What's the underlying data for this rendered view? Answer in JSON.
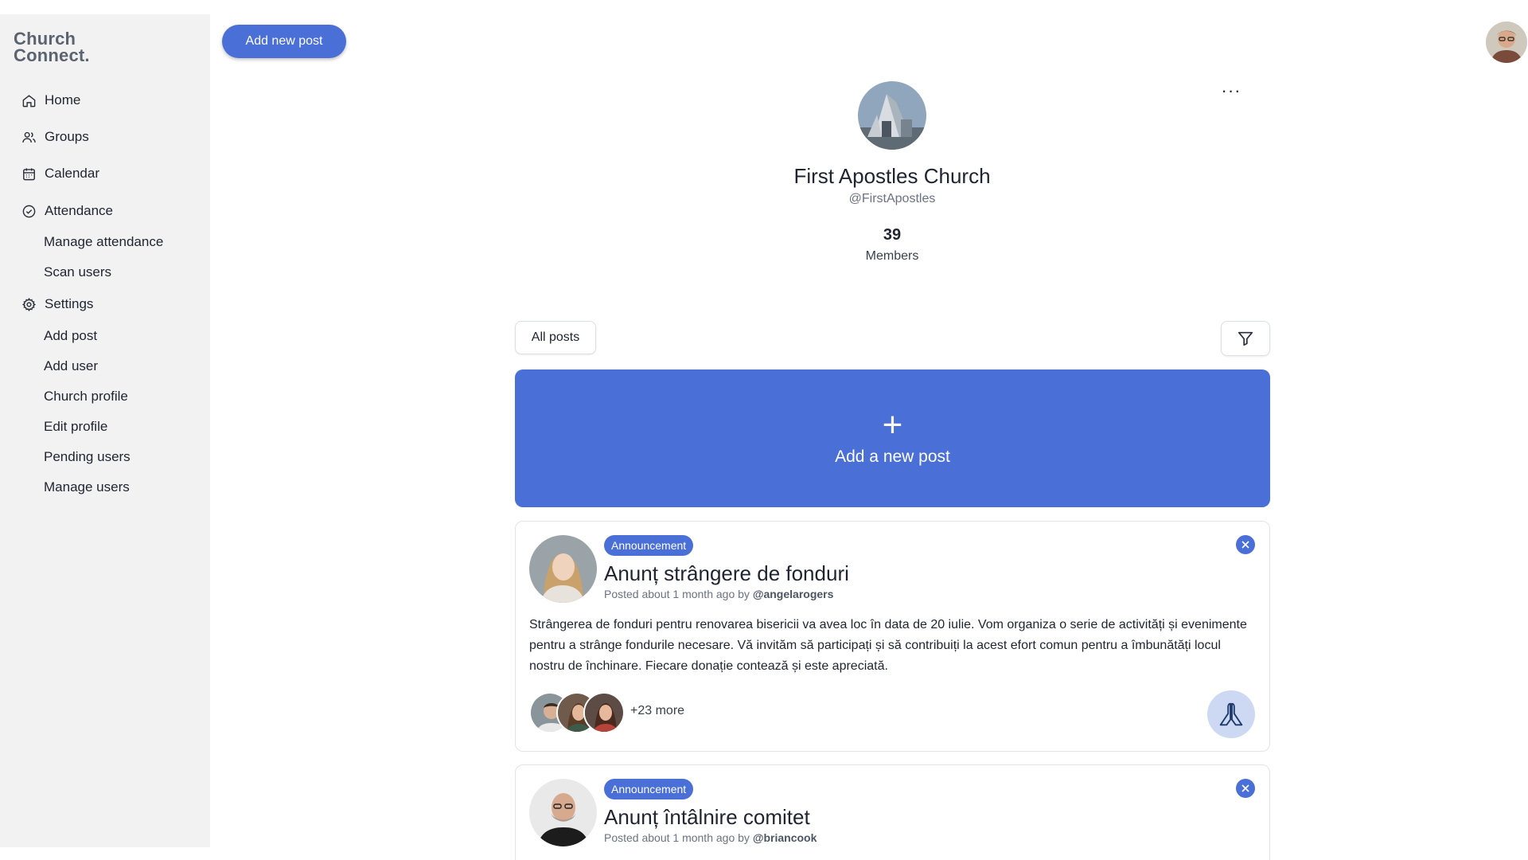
{
  "app": {
    "logo_line1": "Church",
    "logo_line2": "Connect.",
    "top_button": "Add new post"
  },
  "sidebar": {
    "items": [
      {
        "label": "Home",
        "icon": "home-icon"
      },
      {
        "label": "Groups",
        "icon": "users-icon"
      },
      {
        "label": "Calendar",
        "icon": "calendar-icon"
      },
      {
        "label": "Attendance",
        "icon": "check-circle-icon"
      },
      {
        "label": "Settings",
        "icon": "gear-icon"
      }
    ],
    "attendance_sub": [
      "Manage attendance",
      "Scan users"
    ],
    "settings_sub": [
      "Add post",
      "Add user",
      "Church profile",
      "Edit profile",
      "Pending users",
      "Manage users"
    ]
  },
  "church": {
    "name": "First Apostles Church",
    "handle": "@FirstApostles",
    "members_count": "39",
    "members_label": "Members",
    "more_menu": "···"
  },
  "feed": {
    "filter_label": "All posts",
    "add_post_plus": "+",
    "add_post_label": "Add a new post",
    "posts": [
      {
        "badge": "Announcement",
        "title": "Anunț strângere de fonduri",
        "meta_prefix": "Posted about 1 month ago by ",
        "author": "@angelarogers",
        "body": "Strângerea de fonduri pentru renovarea bisericii va avea loc în data de 20 iulie. Vom organiza o serie de activități și evenimente pentru a strânge fondurile necesare. Vă invităm să participați și să contribuiți la acest efort comun pentru a îmbunătăți locul nostru de închinare. Fiecare donație contează și este apreciată.",
        "more_reactions": "+23 more"
      },
      {
        "badge": "Announcement",
        "title": "Anunț întâlnire comitet",
        "meta_prefix": "Posted about 1 month ago by ",
        "author": "@briancook"
      }
    ]
  },
  "colors": {
    "accent": "#4a6fd6",
    "sidebar_bg": "#f2f2f2",
    "pray_bg": "#cdd9f3"
  }
}
